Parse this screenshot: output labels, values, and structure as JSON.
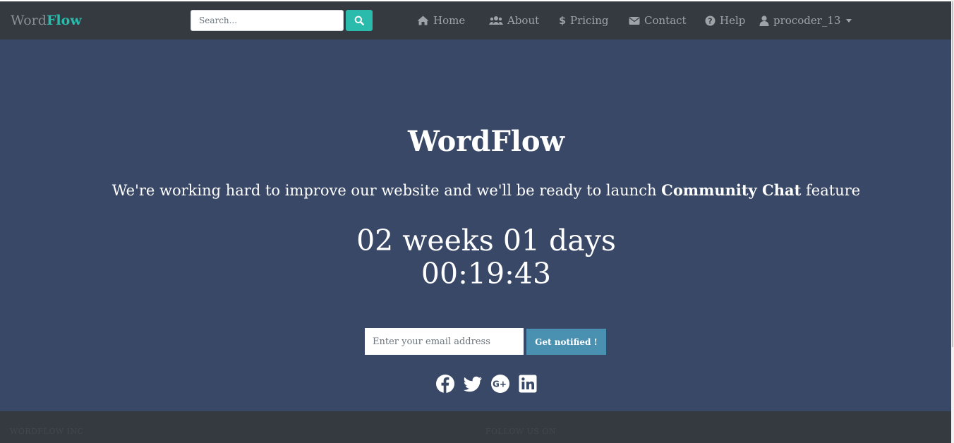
{
  "navbar": {
    "brand_light": "Word",
    "brand_bold": "Flow",
    "search_placeholder": "Search...",
    "links": [
      {
        "label": "Home",
        "icon": "home-icon"
      },
      {
        "label": "About",
        "icon": "users-icon"
      },
      {
        "label": "Pricing",
        "icon": "dollar-icon"
      },
      {
        "label": "Contact",
        "icon": "envelope-icon"
      },
      {
        "label": "Help",
        "icon": "question-circle-icon"
      }
    ],
    "user": {
      "label": "procoder_13",
      "icon": "user-icon"
    }
  },
  "hero": {
    "title": "WordFlow",
    "subtitle_prefix": "We're working hard to improve our website and we'll be ready to launch ",
    "subtitle_bold": "Community Chat",
    "subtitle_suffix": " feature",
    "countdown_line1": "02 weeks 01 days",
    "countdown_line2": "00:19:43",
    "email_placeholder": "Enter your email address",
    "notify_label": "Get notified !",
    "social": [
      "facebook-icon",
      "twitter-icon",
      "google-plus-icon",
      "linkedin-icon"
    ]
  },
  "footer": {
    "left_heading": "WORDFLOW INC",
    "right_heading": "FOLLOW US ON"
  },
  "colors": {
    "navbar_bg": "#343a40",
    "hero_bg": "#394867",
    "accent": "#2bbbad",
    "notify_btn": "#4a90b0"
  }
}
